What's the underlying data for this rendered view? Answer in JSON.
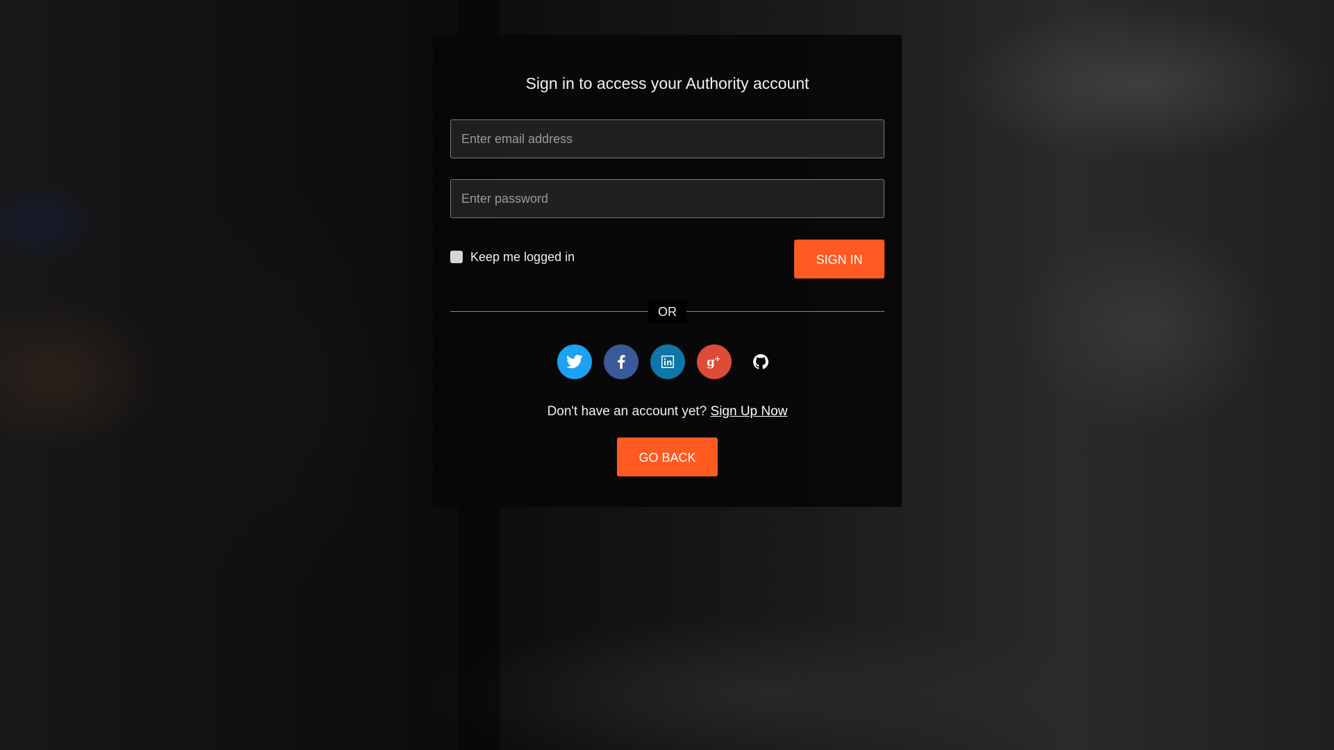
{
  "card": {
    "title": "Sign in to access your Authority account"
  },
  "form": {
    "email_placeholder": "Enter email address",
    "password_placeholder": "Enter password",
    "remember_label": "Keep me logged in",
    "remember_checked": false,
    "sign_in_label": "SIGN IN"
  },
  "divider": {
    "label": "OR"
  },
  "social": [
    {
      "name": "twitter-icon",
      "color": "#1da1f2"
    },
    {
      "name": "facebook-icon",
      "color": "#3b5998"
    },
    {
      "name": "linkedin-icon",
      "color": "#0e76a8"
    },
    {
      "name": "google-plus-icon",
      "color": "#dd4b39"
    },
    {
      "name": "github-icon",
      "color": "#060606"
    }
  ],
  "signup": {
    "prompt": "Don't have an account yet?",
    "link_label": "Sign Up Now"
  },
  "go_back_label": "GO BACK",
  "colors": {
    "accent": "#ff5a21"
  }
}
